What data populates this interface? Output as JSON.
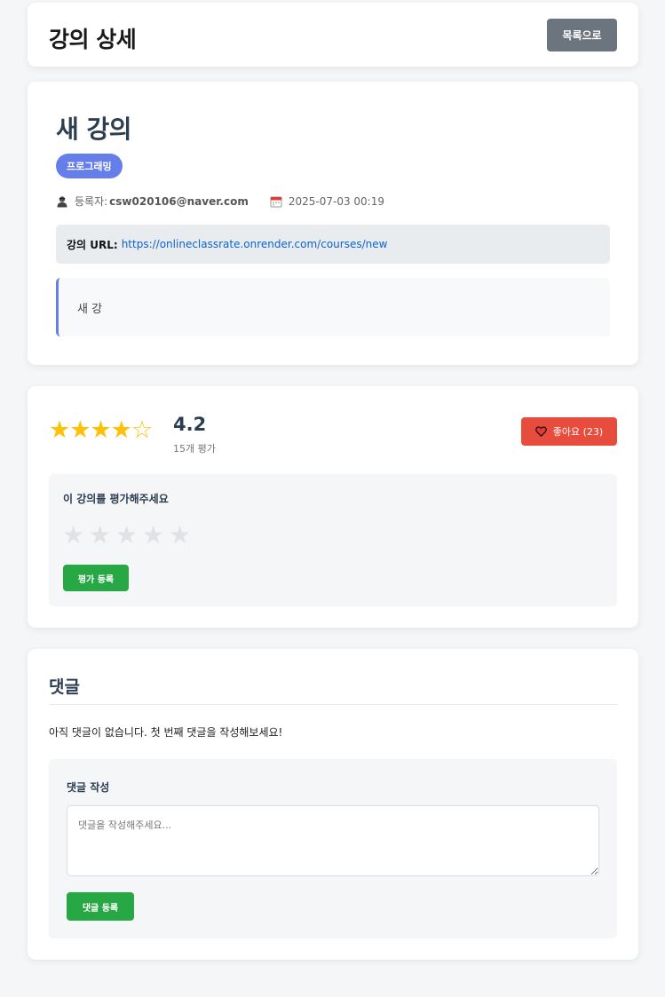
{
  "header": {
    "title": "강의 상세",
    "back_button_label": "목록으로"
  },
  "course": {
    "title": "새 강의",
    "category": "프로그래밍",
    "author_label": "등록자:",
    "author": "csw020106@naver.com",
    "date": "2025-07-03 00:19",
    "url_label": "강의 URL:",
    "url": "https://onlineclassrate.onrender.com/courses/new",
    "description": "새 강",
    "icons": {
      "author": "user-icon",
      "date": "calendar-icon"
    },
    "colors": {
      "accent": "#667eea"
    }
  },
  "rating": {
    "stars": "★★★★☆",
    "average": "4.2",
    "count_text": "15개 평가",
    "like_label": "좋아요 (23)",
    "prompt": "이 강의를 평가해주세요",
    "input_stars": [
      "★",
      "★",
      "★",
      "★",
      "★"
    ],
    "submit_label": "평가 등록",
    "colors": {
      "star": "#ffc107",
      "like": "#e74c3c",
      "submit": "#28a745"
    }
  },
  "comments": {
    "title": "댓글",
    "empty_message": "아직 댓글이 없습니다. 첫 번째 댓글을 작성해보세요!",
    "form_label": "댓글 작성",
    "placeholder": "댓글을 작성해주세요...",
    "submit_label": "댓글 등록"
  }
}
